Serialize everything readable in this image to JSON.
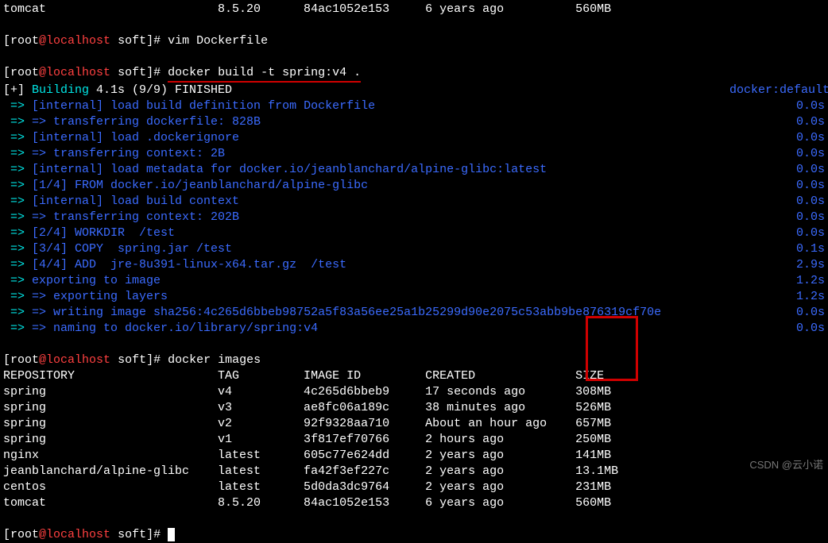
{
  "top_partial": {
    "repo": "tomcat",
    "tag": "8.5.20",
    "image_id": "84ac1052e153",
    "created": "6 years ago",
    "size": "560MB"
  },
  "prompt_user": "root",
  "prompt_at": "@",
  "prompt_host": "localhost",
  "prompt_path": " soft",
  "prompt_bracket_close": "]# ",
  "cmd_vim": "vim Dockerfile",
  "cmd_build": "docker build -t spring:v4 .",
  "build_header_left": "[+] ",
  "build_header_building": "Building ",
  "build_header_rest": "4.1s (9/9) FINISHED",
  "build_header_right": "docker:default",
  "steps": [
    {
      "text": "[internal] load build definition from Dockerfile",
      "time": "0.0s",
      "indent": "=> "
    },
    {
      "text": "=> transferring dockerfile: 828B",
      "time": "0.0s",
      "indent": "=> "
    },
    {
      "text": "[internal] load .dockerignore",
      "time": "0.0s",
      "indent": "=> "
    },
    {
      "text": "=> transferring context: 2B",
      "time": "0.0s",
      "indent": "=> "
    },
    {
      "text": "[internal] load metadata for docker.io/jeanblanchard/alpine-glibc:latest",
      "time": "0.0s",
      "indent": "=> "
    },
    {
      "text": "[1/4] FROM docker.io/jeanblanchard/alpine-glibc",
      "time": "0.0s",
      "indent": "=> "
    },
    {
      "text": "[internal] load build context",
      "time": "0.0s",
      "indent": "=> "
    },
    {
      "text": "=> transferring context: 202B",
      "time": "0.0s",
      "indent": "=> "
    },
    {
      "text": "[2/4] WORKDIR  /test",
      "time": "0.0s",
      "indent": "=> "
    },
    {
      "text": "[3/4] COPY  spring.jar /test",
      "time": "0.1s",
      "indent": "=> "
    },
    {
      "text": "[4/4] ADD  jre-8u391-linux-x64.tar.gz  /test",
      "time": "2.9s",
      "indent": "=> "
    },
    {
      "text": "exporting to image",
      "time": "1.2s",
      "indent": "=> "
    },
    {
      "text": "=> exporting layers",
      "time": "1.2s",
      "indent": "=> "
    },
    {
      "text": "=> writing image sha256:4c265d6bbeb98752a5f83a56ee25a1b25299d90e2075c53abb9be876319cf70e",
      "time": "0.0s",
      "indent": "=> "
    },
    {
      "text": "=> naming to docker.io/library/spring:v4",
      "time": "0.0s",
      "indent": "=> "
    }
  ],
  "cmd_images": "docker images",
  "table_headers": {
    "repo": "REPOSITORY",
    "tag": "TAG",
    "image_id": "IMAGE ID",
    "created": "CREATED",
    "size": "SIZE"
  },
  "images": [
    {
      "repo": "spring",
      "tag": "v4",
      "image_id": "4c265d6bbeb9",
      "created": "17 seconds ago",
      "size": "308MB"
    },
    {
      "repo": "spring",
      "tag": "v3",
      "image_id": "ae8fc06a189c",
      "created": "38 minutes ago",
      "size": "526MB"
    },
    {
      "repo": "spring",
      "tag": "v2",
      "image_id": "92f9328aa710",
      "created": "About an hour ago",
      "size": "657MB"
    },
    {
      "repo": "spring",
      "tag": "v1",
      "image_id": "3f817ef70766",
      "created": "2 hours ago",
      "size": "250MB"
    },
    {
      "repo": "nginx",
      "tag": "latest",
      "image_id": "605c77e624dd",
      "created": "2 years ago",
      "size": "141MB"
    },
    {
      "repo": "jeanblanchard/alpine-glibc",
      "tag": "latest",
      "image_id": "fa42f3ef227c",
      "created": "2 years ago",
      "size": "13.1MB"
    },
    {
      "repo": "centos",
      "tag": "latest",
      "image_id": "5d0da3dc9764",
      "created": "2 years ago",
      "size": "231MB"
    },
    {
      "repo": "tomcat",
      "tag": "8.5.20",
      "image_id": "84ac1052e153",
      "created": "6 years ago",
      "size": "560MB"
    }
  ],
  "watermark": "CSDN @云小诺"
}
